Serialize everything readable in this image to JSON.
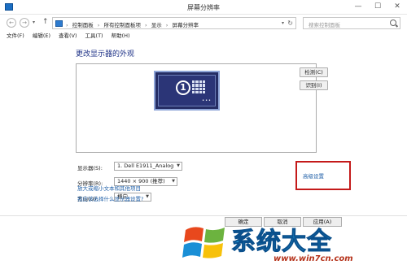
{
  "window": {
    "title": "屏幕分辨率"
  },
  "nav": {
    "crumbs": [
      "控制面板",
      "所有控制面板项",
      "显示",
      "屏幕分辨率"
    ],
    "search_placeholder": "搜索控制面板"
  },
  "menu": [
    "文件(F)",
    "编辑(E)",
    "查看(V)",
    "工具(T)",
    "帮助(H)"
  ],
  "main": {
    "heading": "更改显示器的外观",
    "monitor_number": "1",
    "detect_label": "检测(C)",
    "identify_label": "识别(I)",
    "display": {
      "label": "显示器(S):",
      "value": "1. Dell E1911_Analog"
    },
    "resolution": {
      "label": "分辨率(R):",
      "value": "1440 × 900 (推荐)"
    },
    "orientation": {
      "label": "方向(O):",
      "value": "横向"
    },
    "advanced_link": "高级设置",
    "link_text_size": "放大或缩小文本和其他项目",
    "link_help": "我应该选择什么显示器设置?"
  },
  "buttons": {
    "ok": "确定",
    "cancel": "取消",
    "apply": "应用(A)"
  },
  "watermark": {
    "brand": "系统大全",
    "url": "www.win7cn.com"
  },
  "colors": {
    "accent_link": "#1f5fa7",
    "highlight_box": "#c41a1a",
    "heading": "#1e3287"
  }
}
